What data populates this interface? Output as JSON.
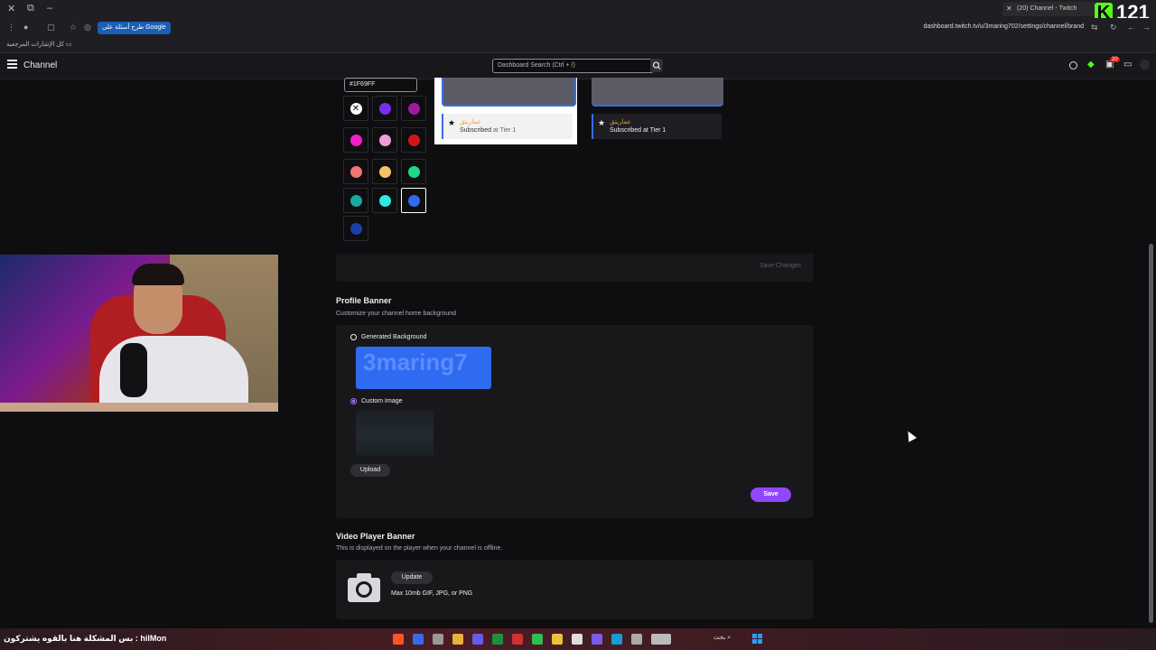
{
  "browser": {
    "tab_title": "(20) Channel - Twitch",
    "translate_pill": "طرح أسئلة على Google",
    "url": "dashboard.twitch.tv/u/3maring702/settings/channel/brand",
    "bookmarks_label": "كل الإشارات المرجعية",
    "overlay_count": "121"
  },
  "header": {
    "title": "Channel",
    "search_placeholder": "Dashboard Search (Ctrl + /)",
    "notification_count": "20"
  },
  "accent_color": {
    "hex_value": "#1F69FF",
    "swatches": [
      "#7b2cf0",
      "#a01b9c",
      "#f21ec8",
      "#f29bd9",
      "#d11616",
      "#f07474",
      "#f5c468",
      "#1ed88a",
      "#1aa89b",
      "#2ee8e2",
      "#2f6bf0",
      "#1a3fa8"
    ],
    "selected_swatch": "#2f6bf0"
  },
  "previews": {
    "light": {
      "username": "عماريتق",
      "tier_prefix": "Subscribed",
      "tier_suffix": "at Tier 1"
    },
    "dark": {
      "username": "عماريتق",
      "tier_text": "Subscribed at Tier 1"
    }
  },
  "save_changes_label": "Save Changes",
  "profile_banner": {
    "title": "Profile Banner",
    "subtitle": "Customize your channel home background",
    "option_generated": "Generated Background",
    "generated_text": "3maring7",
    "option_custom": "Custom Image",
    "upload_label": "Upload",
    "save_label": "Save"
  },
  "video_player_banner": {
    "title": "Video Player Banner",
    "subtitle": "This is displayed on the player when your channel is offline.",
    "update_label": "Update",
    "hint": "Max 10mb GIF, JPG, or PNG"
  },
  "taskbar": {
    "marquee": "بس المشكلة هنا بالقوه يشتركون : hilMon",
    "search_label": "بحث"
  },
  "colors": {
    "twitch_purple": "#9147ff",
    "selected_blue": "#3a6ae8",
    "background": "#0e0e10",
    "panel": "#18181b"
  }
}
